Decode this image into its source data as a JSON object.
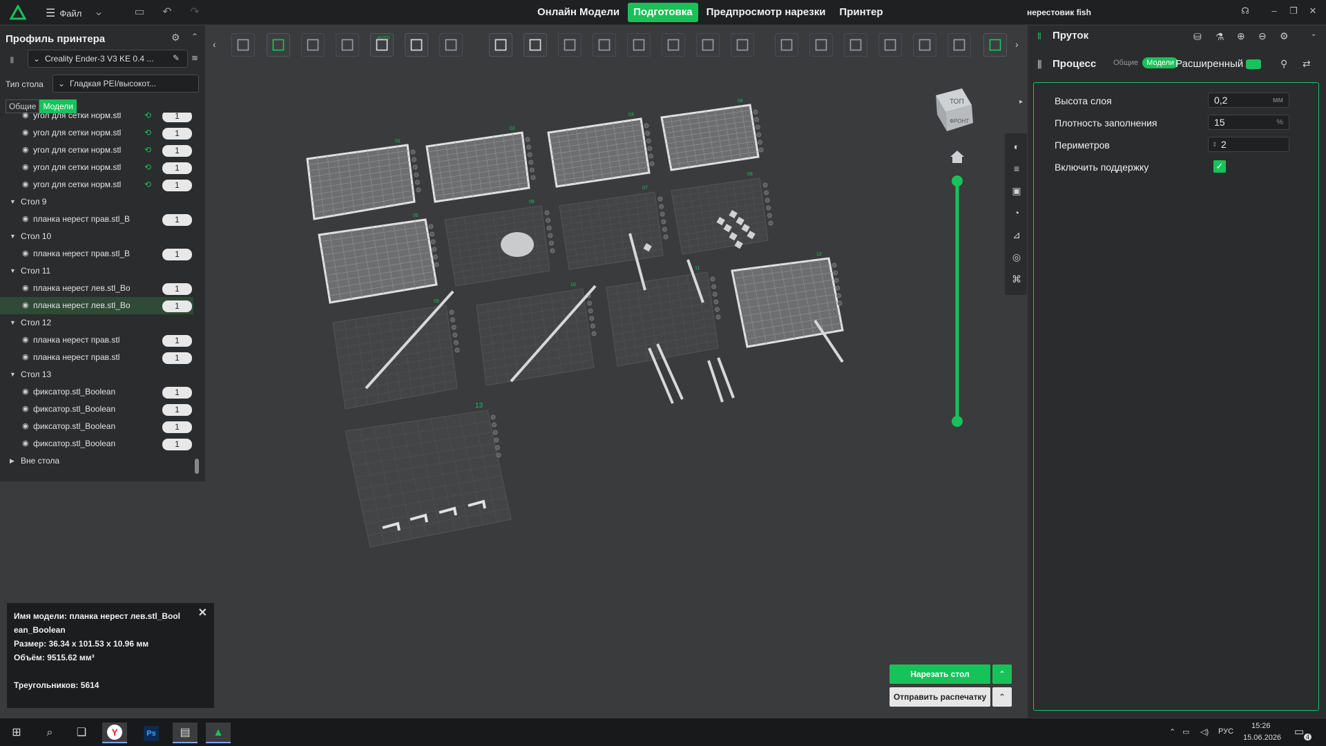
{
  "topbar": {
    "menu_label": "Файл",
    "tabs": [
      {
        "label": "Онлайн Модели",
        "active": false
      },
      {
        "label": "Подготовка",
        "active": true
      },
      {
        "label": "Предпросмотр нарезки",
        "active": false
      },
      {
        "label": "Принтер",
        "active": false
      }
    ],
    "project_name": "нерестовик fish"
  },
  "left_panel": {
    "title": "Профиль принтера",
    "printer": "Creality Ender-3 V3 KE 0.4 ...",
    "bed_type_label": "Тип стола",
    "bed_type_value": "Гладкая PEI/высокот...",
    "seg_general": "Общие",
    "seg_models": "Модели",
    "tree": [
      {
        "kind": "item",
        "name": "угол для сетки  норм.stl",
        "count": "1",
        "changed": true
      },
      {
        "kind": "item",
        "name": "угол для сетки  норм.stl",
        "count": "1",
        "changed": true
      },
      {
        "kind": "item",
        "name": "угол для сетки  норм.stl",
        "count": "1",
        "changed": true
      },
      {
        "kind": "item",
        "name": "угол для сетки  норм.stl",
        "count": "1",
        "changed": true
      },
      {
        "kind": "item",
        "name": "угол для сетки  норм.stl",
        "count": "1",
        "changed": true
      },
      {
        "kind": "group",
        "name": "Стол 9"
      },
      {
        "kind": "item",
        "name": "планка нерест  прав.stl_B",
        "count": "1",
        "changed": false
      },
      {
        "kind": "group",
        "name": "Стол 10"
      },
      {
        "kind": "item",
        "name": "планка нерест  прав.stl_B",
        "count": "1",
        "changed": false
      },
      {
        "kind": "group",
        "name": "Стол 11"
      },
      {
        "kind": "item",
        "name": "планка нерест  лев.stl_Bo",
        "count": "1",
        "changed": false
      },
      {
        "kind": "item",
        "name": "планка нерест  лев.stl_Bo",
        "count": "1",
        "changed": false,
        "selected": true
      },
      {
        "kind": "group",
        "name": "Стол 12"
      },
      {
        "kind": "item",
        "name": "планка нерест  прав.stl",
        "count": "1",
        "changed": false
      },
      {
        "kind": "item",
        "name": "планка нерест  прав.stl",
        "count": "1",
        "changed": false
      },
      {
        "kind": "group",
        "name": "Стол 13"
      },
      {
        "kind": "item",
        "name": "фиксатор.stl_Boolean",
        "count": "1",
        "changed": false
      },
      {
        "kind": "item",
        "name": "фиксатор.stl_Boolean",
        "count": "1",
        "changed": false
      },
      {
        "kind": "item",
        "name": "фиксатор.stl_Boolean",
        "count": "1",
        "changed": false
      },
      {
        "kind": "item",
        "name": "фиксатор.stl_Boolean",
        "count": "1",
        "changed": false
      },
      {
        "kind": "group_collapsed",
        "name": "Вне стола"
      }
    ]
  },
  "info_box": {
    "line1": "Имя модели: планка нерест  лев.stl_Bool",
    "line2": "ean_Boolean",
    "line3": "Размер: 36.34 x 101.53 x 10.96 мм",
    "line4": "Объём: 9515.62 мм³",
    "line5": "Треугольников: 5614"
  },
  "right_panel": {
    "filament_title": "Пруток",
    "process_title": "Процесс",
    "seg_general": "Общие",
    "seg_models": "Модели",
    "advanced_label": "Расширенный",
    "params": [
      {
        "label": "Высота слоя",
        "value": "0,2",
        "unit": "мм"
      },
      {
        "label": "Плотность заполнения",
        "value": "15",
        "unit": "%"
      },
      {
        "label": "Периметров",
        "value": "2",
        "unit": ""
      }
    ],
    "support_label": "Включить поддержку",
    "support_checked": true
  },
  "viewport": {
    "cube_top": "ТОП",
    "cube_front": "ФРОНТ",
    "plate_numbers": [
      "01",
      "02",
      "03",
      "04",
      "05",
      "06",
      "07",
      "08",
      "09",
      "10",
      "11",
      "12",
      "13"
    ]
  },
  "actions": {
    "slice_label": "Нарезать стол",
    "send_label": "Отправить распечатку"
  },
  "taskbar": {
    "lang": "РУС",
    "time": "15:26",
    "date": "15.06.2026",
    "notif": "4"
  },
  "colors": {
    "accent": "#18c25a",
    "bg": "#3a3b3d",
    "panel": "#2b2c2e"
  }
}
